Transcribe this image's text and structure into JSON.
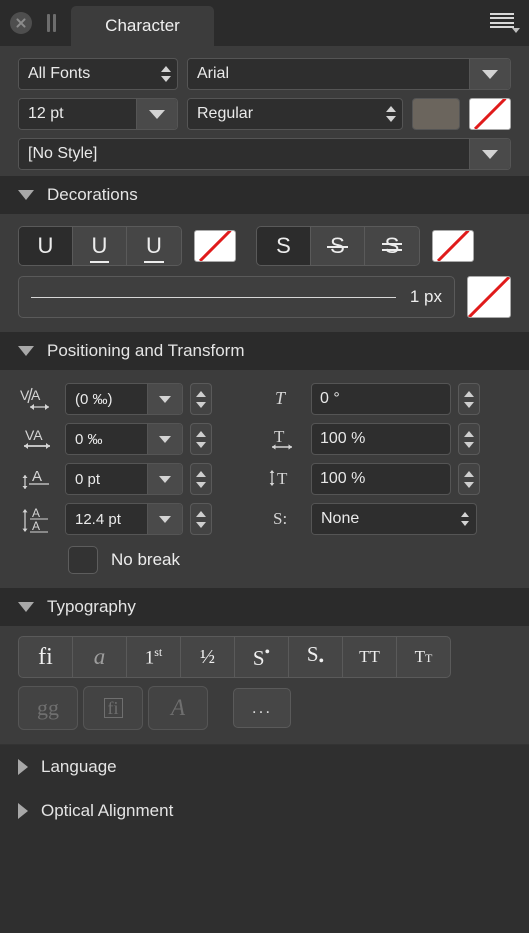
{
  "window": {
    "tab_label": "Character",
    "close_icon": "close-icon",
    "grip_icon": "pause-grip-icon",
    "menu_icon": "hamburger-menu-icon"
  },
  "font_area": {
    "font_family_filter": {
      "value": "All Fonts",
      "icon": "stepper-icon"
    },
    "font_name": {
      "value": "Arial",
      "icon": "chevron-down-icon"
    },
    "font_size": {
      "value": "12 pt",
      "icon": "chevron-down-icon"
    },
    "font_style": {
      "value": "Regular",
      "icon": "stepper-icon"
    },
    "fill_color_swatch": {
      "name": "text-fill-color-swatch",
      "color": "#6b655d"
    },
    "stroke_color_swatch": {
      "name": "text-stroke-color-swatch",
      "color": "none"
    },
    "character_style": {
      "value": "[No Style]",
      "icon": "chevron-down-icon"
    }
  },
  "decorations": {
    "title": "Decorations",
    "expanded": true,
    "underline_group": [
      {
        "name": "underline-none",
        "glyph": "U",
        "selected": true
      },
      {
        "name": "underline-single",
        "glyph": "U",
        "selected": false
      },
      {
        "name": "underline-double",
        "glyph": "U",
        "selected": false
      }
    ],
    "underline_color_swatch": {
      "name": "underline-color-swatch",
      "color": "none"
    },
    "strikethrough_group": [
      {
        "name": "strikethrough-none",
        "glyph": "S",
        "selected": true
      },
      {
        "name": "strikethrough-single",
        "glyph": "S",
        "selected": false
      },
      {
        "name": "strikethrough-double",
        "glyph": "S",
        "selected": false
      }
    ],
    "strikethrough_color_swatch": {
      "name": "strikethrough-color-swatch",
      "color": "none"
    },
    "line_width": {
      "label": "1 px",
      "name": "decoration-line-width"
    },
    "line_width_color_swatch": {
      "name": "decoration-line-color-swatch",
      "color": "none"
    }
  },
  "positioning": {
    "title": "Positioning and Transform",
    "expanded": true,
    "left_fields": [
      {
        "name": "kerning",
        "icon": "kerning-icon",
        "value": "(0 ‰)"
      },
      {
        "name": "tracking",
        "icon": "tracking-icon",
        "value": "0 ‰"
      },
      {
        "name": "baseline-offset",
        "icon": "baseline-offset-icon",
        "value": "0 pt"
      },
      {
        "name": "line-spacing",
        "icon": "line-spacing-icon",
        "value": "12.4 pt"
      }
    ],
    "right_fields": [
      {
        "name": "italic-slant",
        "icon": "italic-slant-icon",
        "value": "0 °"
      },
      {
        "name": "horizontal-scale",
        "icon": "horizontal-scale-icon",
        "value": "100 %"
      },
      {
        "name": "vertical-scale",
        "icon": "vertical-scale-icon",
        "value": "100 %"
      },
      {
        "name": "script-position",
        "icon": "script-label-icon",
        "value": "None"
      }
    ],
    "no_break": {
      "label": "No break",
      "checked": false
    }
  },
  "typography": {
    "title": "Typography",
    "expanded": true,
    "row1": [
      {
        "name": "standard-ligatures-button",
        "glyph": "fi",
        "enabled": true
      },
      {
        "name": "contextual-alternates-button",
        "glyph": "a",
        "enabled": true
      },
      {
        "name": "ordinals-button",
        "glyph": "1st",
        "enabled": true
      },
      {
        "name": "fractions-button",
        "glyph": "½",
        "enabled": true
      },
      {
        "name": "superscript-button",
        "glyph": "S",
        "enabled": true
      },
      {
        "name": "subscript-button",
        "glyph": "S",
        "enabled": true
      },
      {
        "name": "all-caps-button",
        "glyph": "TT",
        "enabled": true
      },
      {
        "name": "small-caps-button",
        "glyph": "TT",
        "enabled": true
      }
    ],
    "row2": [
      {
        "name": "alternate-glyphs-button",
        "glyph": "gg",
        "enabled": false
      },
      {
        "name": "glyph-box-button",
        "glyph": "fi",
        "enabled": false
      },
      {
        "name": "swash-button",
        "glyph": "A",
        "enabled": false
      }
    ],
    "more_button": {
      "name": "more-options-button",
      "label": "..."
    }
  },
  "sections": [
    {
      "name": "language-section",
      "title": "Language",
      "expanded": false
    },
    {
      "name": "optical-alignment-section",
      "title": "Optical Alignment",
      "expanded": false
    }
  ]
}
